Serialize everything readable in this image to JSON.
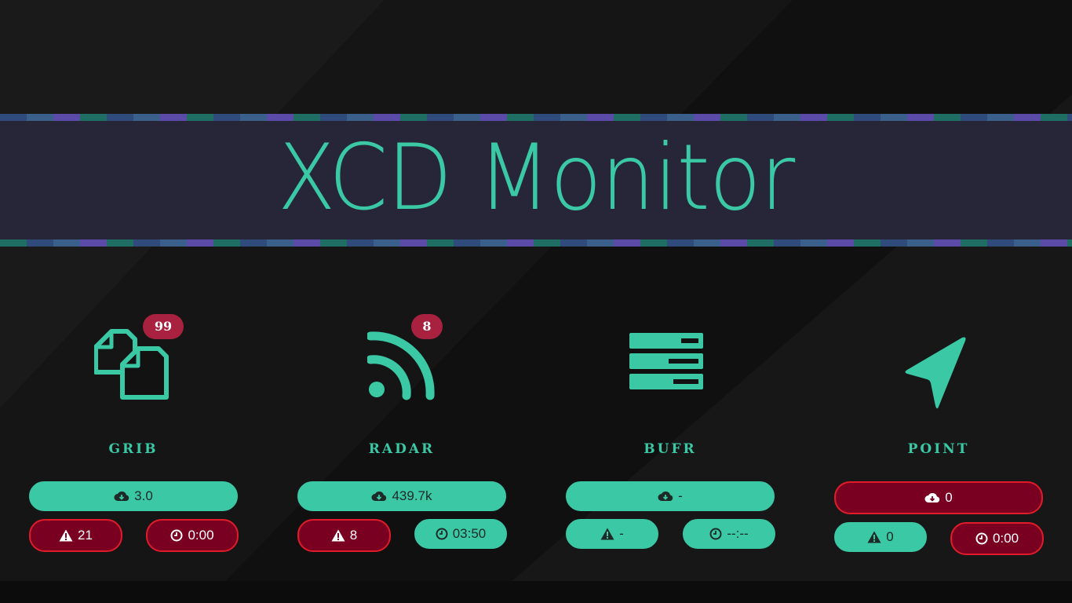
{
  "app": {
    "title": "XCD Monitor"
  },
  "colors": {
    "background": "#121212",
    "banner": "#272638",
    "accent": "#3ac8a5",
    "alert_fill": "#7a0021",
    "alert_border": "#e01c2a",
    "count_badge": "#a8213f",
    "stripe_palette": [
      "#2f4b7c",
      "#1f6e63",
      "#5b4aa8",
      "#3a5f8a"
    ]
  },
  "monitors": [
    {
      "label": "GRIB",
      "icon": "files-icon",
      "badge": "99",
      "download": {
        "text": "3.0",
        "status": "ok"
      },
      "alerts": {
        "text": "21",
        "status": "error"
      },
      "time": {
        "text": "0:00",
        "status": "error"
      }
    },
    {
      "label": "RADAR",
      "icon": "rss-feed-icon",
      "badge": "8",
      "download": {
        "text": "439.7k",
        "status": "ok"
      },
      "alerts": {
        "text": "8",
        "status": "error"
      },
      "time": {
        "text": "03:50",
        "status": "ok"
      }
    },
    {
      "label": "BUFR",
      "icon": "server-icon",
      "badge": "",
      "download": {
        "text": "-",
        "status": "ok"
      },
      "alerts": {
        "text": "-",
        "status": "ok"
      },
      "time": {
        "text": "--:--",
        "status": "ok"
      }
    },
    {
      "label": "POINT",
      "icon": "location-arrow-icon",
      "badge": "",
      "download": {
        "text": "0",
        "status": "error"
      },
      "alerts": {
        "text": "0",
        "status": "ok"
      },
      "time": {
        "text": "0:00",
        "status": "error"
      }
    }
  ]
}
